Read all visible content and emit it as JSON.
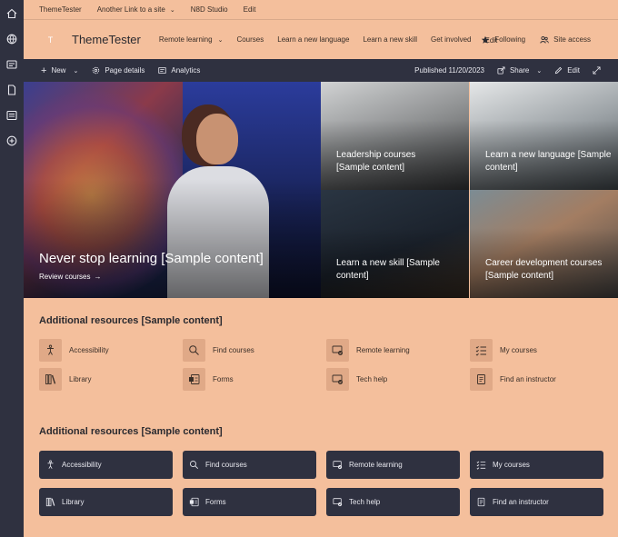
{
  "rail": {
    "icons": [
      "home-icon",
      "globe-icon",
      "news-icon",
      "document-icon",
      "list-icon",
      "add-icon"
    ]
  },
  "hub": {
    "items": [
      {
        "label": "ThemeTester"
      },
      {
        "label": "Another Link to a site"
      },
      {
        "label": "N8D Studio"
      },
      {
        "label": "Edit"
      }
    ]
  },
  "site": {
    "logo_letter": "T",
    "title": "ThemeTester",
    "nav": [
      {
        "label": "Remote learning"
      },
      {
        "label": "Courses"
      },
      {
        "label": "Learn a new language"
      },
      {
        "label": "Learn a new skill"
      },
      {
        "label": "Get involved"
      },
      {
        "label": "Edit"
      }
    ],
    "following_label": "Following",
    "site_access_label": "Site access"
  },
  "command": {
    "new_label": "New",
    "page_details_label": "Page details",
    "analytics_label": "Analytics",
    "published_label": "Published 11/20/2023",
    "share_label": "Share",
    "edit_label": "Edit"
  },
  "hero": {
    "main_title": "Never stop learning [Sample content]",
    "main_link": "Review courses",
    "tiles": [
      {
        "title": "Leadership courses [Sample content]"
      },
      {
        "title": "Learn a new language [Sample content]"
      },
      {
        "title": "Learn a new skill [Sample content]"
      },
      {
        "title": "Career development courses [Sample content]"
      }
    ]
  },
  "resources1": {
    "title": "Additional resources [Sample content]",
    "items": [
      {
        "label": "Accessibility",
        "icon": "accessibility-icon"
      },
      {
        "label": "Find courses",
        "icon": "search-icon"
      },
      {
        "label": "Remote learning",
        "icon": "remote-learning-icon"
      },
      {
        "label": "My courses",
        "icon": "checklist-icon"
      },
      {
        "label": "Library",
        "icon": "library-icon"
      },
      {
        "label": "Forms",
        "icon": "forms-icon"
      },
      {
        "label": "Tech help",
        "icon": "tech-help-icon"
      },
      {
        "label": "Find an instructor",
        "icon": "instructor-icon"
      }
    ]
  },
  "resources2": {
    "title": "Additional resources [Sample content]",
    "items": [
      {
        "label": "Accessibility",
        "icon": "accessibility-icon"
      },
      {
        "label": "Find courses",
        "icon": "search-icon"
      },
      {
        "label": "Remote learning",
        "icon": "remote-learning-icon"
      },
      {
        "label": "My courses",
        "icon": "checklist-icon"
      },
      {
        "label": "Library",
        "icon": "library-icon"
      },
      {
        "label": "Forms",
        "icon": "forms-icon"
      },
      {
        "label": "Tech help",
        "icon": "tech-help-icon"
      },
      {
        "label": "Find an instructor",
        "icon": "instructor-icon"
      }
    ]
  },
  "colors": {
    "accent": "#f4bf9c",
    "dark": "#2f3140",
    "icon_tile": "#e0a987"
  }
}
